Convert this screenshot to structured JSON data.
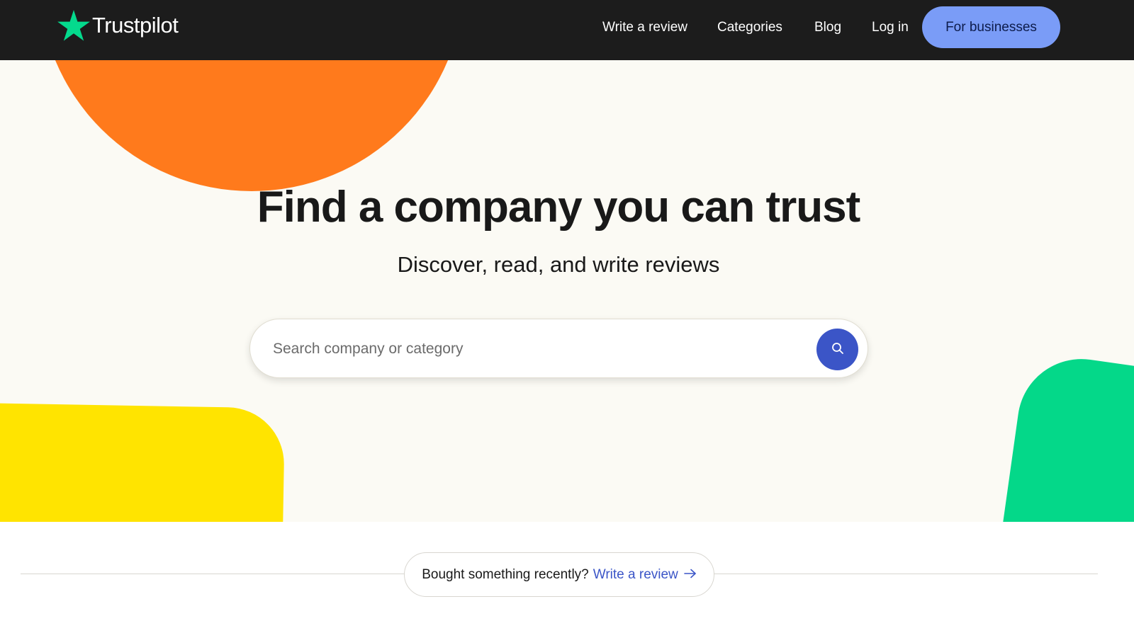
{
  "header": {
    "logo_text": "Trustpilot",
    "nav": {
      "write_review": "Write a review",
      "categories": "Categories",
      "blog": "Blog",
      "login": "Log in",
      "for_businesses": "For businesses"
    }
  },
  "hero": {
    "title": "Find a company you can trust",
    "subtitle": "Discover, read, and write reviews",
    "search": {
      "placeholder": "Search company or category",
      "value": "",
      "button_icon": "search-icon"
    }
  },
  "recent": {
    "question": "Bought something recently?",
    "link_label": "Write a review",
    "link_icon": "arrow-right-icon"
  },
  "colors": {
    "header_bg": "#1c1c1c",
    "star_green": "#04da8d",
    "accent_blue": "#3b55c7",
    "business_button": "#7a9cf7",
    "orange": "#ff7a1c",
    "yellow": "#ffe400",
    "green": "#04d889"
  }
}
